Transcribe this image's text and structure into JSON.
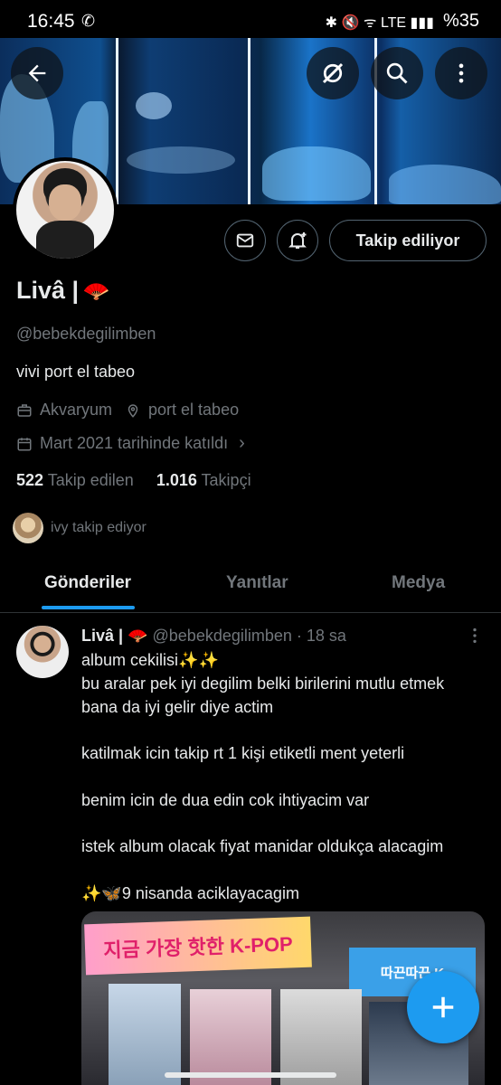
{
  "status_bar": {
    "time": "16:45",
    "battery": "%35",
    "indicators": "✱ 🔇 ᯤ LTE ▮▮▮"
  },
  "header_buttons": {
    "back_icon": "arrow-left",
    "grok_icon": "grok",
    "search_icon": "search",
    "more_icon": "more-vertical"
  },
  "profile": {
    "name": "Livâ |",
    "emoji": "🪭",
    "handle": "@bebekdegilimben",
    "bio": "vivi port el tabeo",
    "work": "Akvaryum",
    "location": "port el tabeo",
    "joined": "Mart 2021 tarihinde katıldı",
    "following_count": "522",
    "following_label": "Takip edilen",
    "followers_count": "1.016",
    "followers_label": "Takipçi",
    "followed_by": "ivy takip ediyor",
    "follow_button": "Takip ediliyor"
  },
  "tabs": [
    "Gönderiler",
    "Yanıtlar",
    "Medya"
  ],
  "post": {
    "name": "Livâ |",
    "emoji": "🪭",
    "handle": "@bebekdegilimben",
    "time": "· 18 sa",
    "lines": [
      "album cekilisi✨✨",
      "bu aralar pek iyi degilim belki birilerini mutlu etmek",
      "bana da iyi gelir diye actim",
      "",
      "katilmak icin takip rt 1 kişi etiketli ment yeterli",
      "",
      "benim icin de dua edin cok ihtiyacim var",
      "",
      "istek album olacak fiyat manidar oldukça alacagim",
      "",
      "✨🦋9 nisanda aciklayacagim"
    ],
    "image_sign_text": "지금 가장 핫한 K-POP",
    "image_sign2_text": "따끈따끈 K"
  },
  "fab_icon": "plus",
  "colors": {
    "accent": "#1d9bf0",
    "text": "#e7e9ea",
    "muted": "#71767b",
    "bg": "#000000"
  }
}
